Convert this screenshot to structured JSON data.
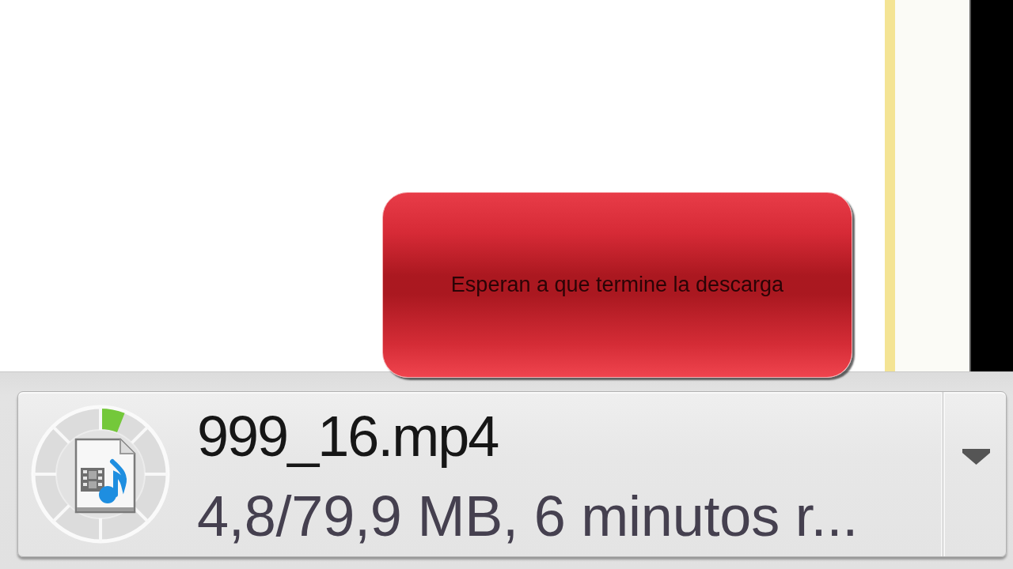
{
  "annotation": {
    "text": "Esperan a que termine la descarga"
  },
  "download_shelf": {
    "items": [
      {
        "filename": "999_16.mp4",
        "status": "4,8/79,9 MB, 6 minutos r...",
        "level": 0.06
      }
    ]
  }
}
